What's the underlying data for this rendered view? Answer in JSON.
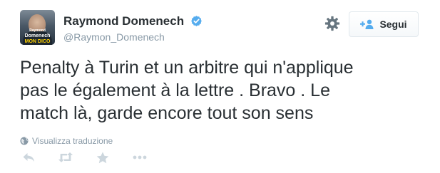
{
  "user": {
    "display_name": "Raymond Domenech",
    "handle": "@Raymon_Domenech",
    "verified": true,
    "avatar_text": [
      "Raymond",
      "Domenech",
      "MON DICO"
    ]
  },
  "follow_button": {
    "label": "Segui",
    "icon": "add-user-icon"
  },
  "settings": {
    "icon": "gear-icon"
  },
  "tweet": {
    "text_lines": [
      "Penalty à Turin et un arbitre qui n'applique",
      "pas le également à la lettre . Bravo . Le",
      "match là, garde encore tout son sens"
    ]
  },
  "translate": {
    "label": "Visualizza traduzione",
    "icon": "globe-icon"
  },
  "actions": [
    {
      "name": "reply",
      "icon": "reply-icon"
    },
    {
      "name": "retweet",
      "icon": "retweet-icon"
    },
    {
      "name": "favorite",
      "icon": "star-icon"
    },
    {
      "name": "more",
      "icon": "more-icon"
    }
  ],
  "colors": {
    "text": "#292f33",
    "secondary": "#8899a6",
    "verified": "#55acee",
    "action_icons": "#ccd6dd",
    "follow_icon": "#55acee"
  }
}
